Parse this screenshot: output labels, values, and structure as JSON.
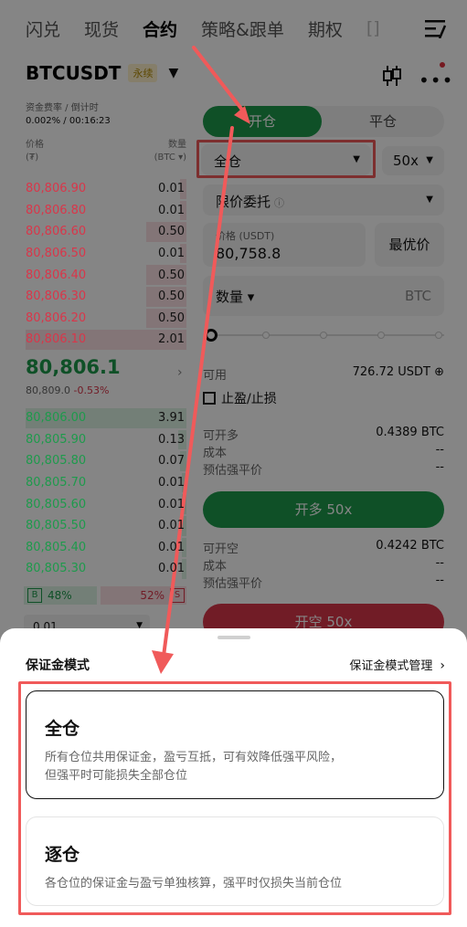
{
  "topnav": {
    "tabs": [
      "闪兑",
      "现货",
      "合约",
      "策略&跟单",
      "期权",
      "[]"
    ],
    "active_index": 2
  },
  "symbol": {
    "name": "BTCUSDT",
    "badge": "永续"
  },
  "funding": {
    "label": "资金费率 / 倒计时",
    "value": "0.002% / 00:16:23"
  },
  "orderbook": {
    "price_label": "价格",
    "price_unit": "(₮)",
    "qty_label": "数量",
    "qty_unit": "(BTC ▾)",
    "asks": [
      {
        "price": "80,806.90",
        "qty": "0.01",
        "depth": 0.04
      },
      {
        "price": "80,806.80",
        "qty": "0.01",
        "depth": 0.04
      },
      {
        "price": "80,806.60",
        "qty": "0.50",
        "depth": 0.25
      },
      {
        "price": "80,806.50",
        "qty": "0.01",
        "depth": 0.04
      },
      {
        "price": "80,806.40",
        "qty": "0.50",
        "depth": 0.25
      },
      {
        "price": "80,806.30",
        "qty": "0.50",
        "depth": 0.25
      },
      {
        "price": "80,806.20",
        "qty": "0.50",
        "depth": 0.25
      },
      {
        "price": "80,806.10",
        "qty": "2.01",
        "depth": 1.0
      }
    ],
    "last_price": "80,806.1",
    "sub_price": "80,809.0",
    "change": "-0.53%",
    "bids": [
      {
        "price": "80,806.00",
        "qty": "3.91",
        "depth": 1.0
      },
      {
        "price": "80,805.90",
        "qty": "0.13",
        "depth": 0.05
      },
      {
        "price": "80,805.80",
        "qty": "0.07",
        "depth": 0.04
      },
      {
        "price": "80,805.70",
        "qty": "0.01",
        "depth": 0.03
      },
      {
        "price": "80,805.60",
        "qty": "0.01",
        "depth": 0.03
      },
      {
        "price": "80,805.50",
        "qty": "0.01",
        "depth": 0.03
      },
      {
        "price": "80,805.40",
        "qty": "0.01",
        "depth": 0.03
      },
      {
        "price": "80,805.30",
        "qty": "0.01",
        "depth": 0.03
      }
    ],
    "buy_ratio": "48%",
    "sell_ratio": "52%",
    "buy_letter": "B",
    "sell_letter": "S",
    "step": "0.01"
  },
  "trade": {
    "open_tab": "开仓",
    "close_tab": "平仓",
    "margin_mode": "全仓",
    "leverage": "50x",
    "order_type": "限价委托",
    "order_type_info": "ⓘ",
    "price_label": "价格 (USDT)",
    "price_value": "80,758.8",
    "best_price": "最优价",
    "qty_label": "数量 ▾",
    "qty_unit": "BTC",
    "avail_label": "可用",
    "avail_value": "726.72 USDT ⊕",
    "tpsl": "止盈/止损",
    "long_rows": [
      {
        "label": "可开多",
        "value": "0.4389 BTC"
      },
      {
        "label": "成本",
        "value": "--"
      },
      {
        "label": "预估强平价",
        "value": "--"
      }
    ],
    "long_button": "开多 50x",
    "short_rows": [
      {
        "label": "可开空",
        "value": "0.4242 BTC"
      },
      {
        "label": "成本",
        "value": "--"
      },
      {
        "label": "预估强平价",
        "value": "--"
      }
    ],
    "short_button": "开空 50x"
  },
  "sheet": {
    "title": "保证金模式",
    "manage": "保证金模式管理",
    "options": [
      {
        "title": "全仓",
        "desc_1": "所有仓位共用保证金，盈亏互抵，可有效降低强平风险，",
        "desc_2": "但强平时可能损失全部仓位",
        "selected": true
      },
      {
        "title": "逐仓",
        "desc_1": "各仓位的保证金与盈亏单独核算，强平时仅损失当前仓位",
        "selected": false
      }
    ]
  },
  "colors": {
    "green": "#1e9a4c",
    "red": "#d9364a",
    "annotation": "#f05a5a"
  }
}
